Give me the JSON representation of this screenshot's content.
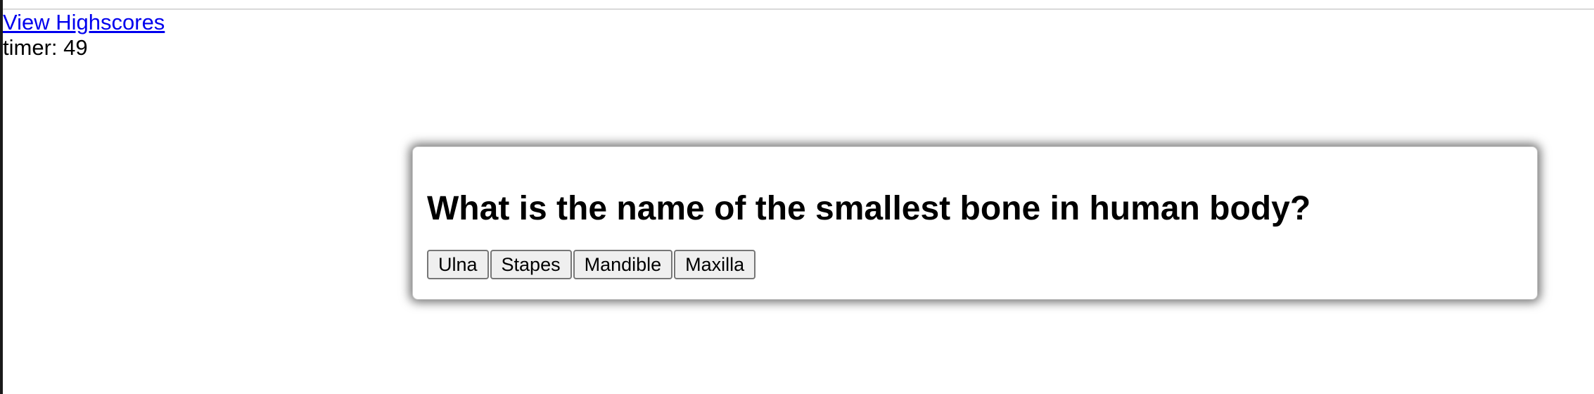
{
  "nav": {
    "highscores_link": "View Highscores"
  },
  "timer": {
    "text": "timer: 49"
  },
  "quiz": {
    "question": "What is the name of the smallest bone in human body?",
    "answers": [
      {
        "label": "Ulna"
      },
      {
        "label": "Stapes"
      },
      {
        "label": "Mandible"
      },
      {
        "label": "Maxilla"
      }
    ]
  }
}
